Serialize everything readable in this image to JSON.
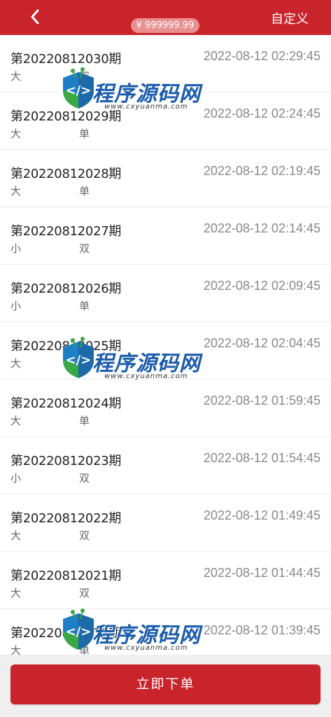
{
  "header": {
    "balance": "¥ 999999.99",
    "custom_label": "自定义"
  },
  "records": [
    {
      "period": "第20220812030期",
      "time": "2022-08-12 02:29:45",
      "size": "大",
      "parity": "双"
    },
    {
      "period": "第20220812029期",
      "time": "2022-08-12 02:24:45",
      "size": "大",
      "parity": "单"
    },
    {
      "period": "第20220812028期",
      "time": "2022-08-12 02:19:45",
      "size": "大",
      "parity": "单"
    },
    {
      "period": "第20220812027期",
      "time": "2022-08-12 02:14:45",
      "size": "小",
      "parity": "双"
    },
    {
      "period": "第20220812026期",
      "time": "2022-08-12 02:09:45",
      "size": "小",
      "parity": "单"
    },
    {
      "period": "第20220812025期",
      "time": "2022-08-12 02:04:45",
      "size": "大",
      "parity": ""
    },
    {
      "period": "第20220812024期",
      "time": "2022-08-12 01:59:45",
      "size": "大",
      "parity": "单"
    },
    {
      "period": "第20220812023期",
      "time": "2022-08-12 01:54:45",
      "size": "小",
      "parity": "双"
    },
    {
      "period": "第20220812022期",
      "time": "2022-08-12 01:49:45",
      "size": "大",
      "parity": "双"
    },
    {
      "period": "第20220812021期",
      "time": "2022-08-12 01:44:45",
      "size": "大",
      "parity": "双"
    },
    {
      "period": "第20220812020期",
      "time": "2022-08-12 01:39:45",
      "size": "大",
      "parity": "单"
    }
  ],
  "footer": {
    "order_label": "立即下单"
  },
  "watermark": {
    "text": "程序源码网",
    "url": "www.cxyuanma.com"
  },
  "colors": {
    "brand_red": "#c9232b",
    "balance_pill": "#e98f8f",
    "watermark_blue": "#1b5cab"
  }
}
